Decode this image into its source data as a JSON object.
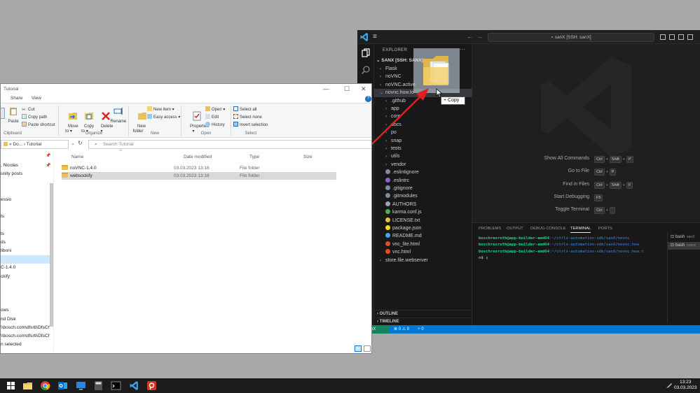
{
  "vscode": {
    "search": "sanX [SSH: sanX]",
    "explorer_title": "EXPLORER",
    "explorer_more": "···",
    "root": "SANX [SSH: SANX]",
    "tree": [
      {
        "label": "Flask",
        "kind": "folder",
        "indent": 1
      },
      {
        "label": "noVNC",
        "kind": "folder",
        "indent": 1
      },
      {
        "label": "noVNC.active",
        "kind": "folder",
        "indent": 1
      },
      {
        "label": "novnc.how.to",
        "kind": "folder-open",
        "indent": 1
      },
      {
        "label": ".github",
        "kind": "folder",
        "indent": 2
      },
      {
        "label": "app",
        "kind": "folder",
        "indent": 2
      },
      {
        "label": "core",
        "kind": "folder",
        "indent": 2
      },
      {
        "label": "docs",
        "kind": "folder",
        "indent": 2
      },
      {
        "label": "po",
        "kind": "folder",
        "indent": 2
      },
      {
        "label": "snap",
        "kind": "folder",
        "indent": 2
      },
      {
        "label": "tests",
        "kind": "folder",
        "indent": 2
      },
      {
        "label": "utils",
        "kind": "folder",
        "indent": 2
      },
      {
        "label": "vendor",
        "kind": "folder",
        "indent": 2
      },
      {
        "label": ".eslintignore",
        "kind": "file",
        "color": "#7f8c99",
        "indent": 2
      },
      {
        "label": ".eslintrc",
        "kind": "file",
        "color": "#8e5fd6",
        "indent": 2
      },
      {
        "label": ".gitignore",
        "kind": "file",
        "color": "#7f8c99",
        "indent": 2
      },
      {
        "label": ".gitmodules",
        "kind": "file",
        "color": "#7f8c99",
        "indent": 2
      },
      {
        "label": "AUTHORS",
        "kind": "file",
        "color": "#9aa6b2",
        "indent": 2
      },
      {
        "label": "karma.conf.js",
        "kind": "file",
        "color": "#4caf50",
        "indent": 2
      },
      {
        "label": "LICENSE.txt",
        "kind": "file",
        "color": "#e5c03b",
        "indent": 2
      },
      {
        "label": "package.json",
        "kind": "file",
        "color": "#f5de19",
        "indent": 2
      },
      {
        "label": "README.md",
        "kind": "file",
        "color": "#42a5f5",
        "indent": 2
      },
      {
        "label": "vnc_lite.html",
        "kind": "file",
        "color": "#e44d26",
        "indent": 2
      },
      {
        "label": "vnc.html",
        "kind": "file",
        "color": "#e44d26",
        "indent": 2
      },
      {
        "label": "store.file.webserver",
        "kind": "folder",
        "indent": 1
      }
    ],
    "outline": "OUTLINE",
    "timeline": "TIMELINE",
    "shortcuts": [
      {
        "label": "Show All Commands",
        "keys": [
          "Ctrl",
          "+",
          "Shift",
          "+",
          "P"
        ]
      },
      {
        "label": "Go to File",
        "keys": [
          "Ctrl",
          "+",
          "P"
        ]
      },
      {
        "label": "Find in Files",
        "keys": [
          "Ctrl",
          "+",
          "Shift",
          "+",
          "F"
        ]
      },
      {
        "label": "Start Debugging",
        "keys": [
          "F5"
        ]
      },
      {
        "label": "Toggle Terminal",
        "keys": [
          "Ctrl",
          "+",
          "`"
        ]
      }
    ],
    "panel_tabs": [
      "PROBLEMS",
      "OUTPUT",
      "DEBUG CONSOLE",
      "TERMINAL",
      "PORTS"
    ],
    "terminal": [
      {
        "user": "boschrexroth@app-builder-amd64",
        "path": ":~/ctrlx-automation-sdk/sanX/novnc"
      },
      {
        "user": "boschrexroth@app-builder-amd64",
        "path": ":~/ctrlx-automation-sdk/sanX/novnc.how"
      },
      {
        "user": "boschrexroth@app-builder-amd64",
        "path": ":~/ctrlx-automation-sdk/sanX/novnc.how.t"
      },
      {
        "user": "",
        "path": "o$ ▯"
      }
    ],
    "terminals": [
      {
        "name": "bash",
        "host": "sanX"
      },
      {
        "name": "bash",
        "host": "novnc"
      }
    ],
    "status": {
      "remote": "⇄ sanX",
      "problems": "⊗ 0 ⚠ 0",
      "ports": "⑂ 0"
    },
    "drag_tooltip": "+ Copy",
    "accent": "#0078d4"
  },
  "file_explorer": {
    "title": "Tutorial",
    "tabs": [
      "Share",
      "View"
    ],
    "ribbon": {
      "paste_big": "Paste",
      "cut": "Cut",
      "copy_path": "Copy path",
      "paste_shortcut": "Paste shortcut",
      "clipboard": "Clipboard",
      "move_to": "Move\nto ▾",
      "copy_to": "Copy\nto ▾",
      "delete": "Delete\n▾",
      "rename": "Rename",
      "organize": "Organize",
      "new_folder": "New\nfolder",
      "new_item": "New item ▾",
      "easy_access": "Easy access ▾",
      "new": "New",
      "properties": "Properties\n▾",
      "open": "Open ▾",
      "edit": "Edit",
      "history": "History",
      "open_group": "Open",
      "select_all": "Select all",
      "select_none": "Select none",
      "invert": "Invert selection",
      "select": "Select"
    },
    "address": "« Do... › Tutorial",
    "search_placeholder": "Search Tutorial",
    "nav": [
      ", Nicolas",
      "unity posts",
      "",
      "",
      "essio",
      "",
      "ts",
      "",
      "ts",
      "ds",
      "liboni",
      "",
      "C-1.4.0",
      "ckify",
      "",
      "",
      "",
      "ows",
      "nd Disk",
      "\\\\bosch.com\\dfsrb\\DfsCh",
      "\\\\bosch.com\\dfsrb\\DfsCh",
      "n selected"
    ],
    "columns": [
      "Name",
      "Date modified",
      "Type",
      "Size"
    ],
    "rows": [
      {
        "name": "noVNC-1.4.0",
        "date": "03.03.2023 13:18",
        "type": "File folder",
        "size": ""
      },
      {
        "name": "websockify",
        "date": "03.03.2023 13:18",
        "type": "File folder",
        "size": ""
      }
    ]
  },
  "taskbar": {
    "time": "13:23",
    "date": "03.03.2023"
  }
}
